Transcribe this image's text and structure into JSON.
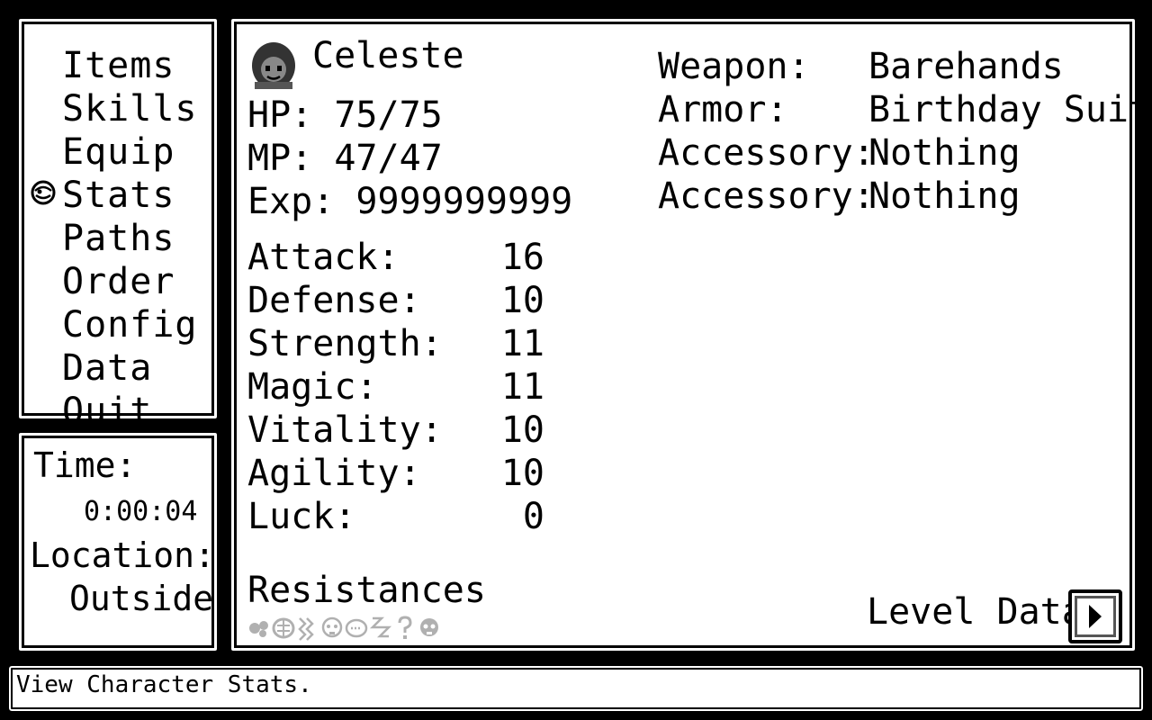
{
  "menu": {
    "items": [
      {
        "label": "Items"
      },
      {
        "label": "Skills"
      },
      {
        "label": "Equip"
      },
      {
        "label": "Stats"
      },
      {
        "label": "Paths"
      },
      {
        "label": "Order"
      },
      {
        "label": "Config"
      },
      {
        "label": "Data"
      },
      {
        "label": "Quit"
      }
    ],
    "selected_index": 3,
    "cursor_icon": "orb-cursor-icon"
  },
  "info": {
    "time_label": "Time:",
    "time_value": "0:00:04",
    "location_label": "Location:",
    "location_value": "Outside"
  },
  "character": {
    "name": "Celeste",
    "portrait_icon": "character-portrait-icon",
    "hp": "HP: 75/75",
    "mp": "MP: 47/47",
    "exp": "Exp: 9999999999",
    "stats": [
      {
        "label": "Attack:",
        "value": "16"
      },
      {
        "label": "Defense:",
        "value": "10"
      },
      {
        "label": "Strength:",
        "value": "11"
      },
      {
        "label": "Magic:",
        "value": "11"
      },
      {
        "label": "Vitality:",
        "value": "10"
      },
      {
        "label": "Agility:",
        "value": "10"
      },
      {
        "label": "Luck:",
        "value": "0"
      }
    ]
  },
  "equipment": [
    {
      "slot": "Weapon:",
      "item": "Barehands"
    },
    {
      "slot": "Armor:",
      "item": "Birthday Suit"
    },
    {
      "slot": "Accessory:",
      "item": "Nothing"
    },
    {
      "slot": "Accessory:",
      "item": "Nothing"
    }
  ],
  "resistances": {
    "title": "Resistances",
    "icons": [
      "poison-icon",
      "brain-icon",
      "wave-icon",
      "skull-icon",
      "silence-icon",
      "sleep-icon",
      "confusion-icon",
      "death-icon"
    ]
  },
  "level_data": {
    "label": "Level Data",
    "button_icon": "right-arrow-icon"
  },
  "help": {
    "text": "View Character Stats."
  },
  "colors": {
    "border": "#000000",
    "background": "#ffffff",
    "resist_icon": "#b0b0b0"
  }
}
